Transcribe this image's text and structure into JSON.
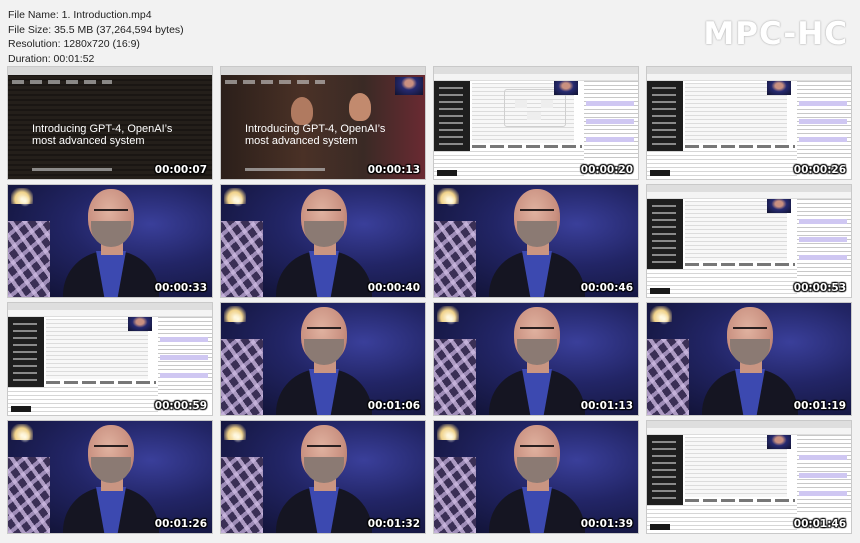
{
  "file_info": {
    "name": "File Name: 1. Introduction.mp4",
    "size": "File Size: 35.5 MB (37,264,594 bytes)",
    "resolution": "Resolution: 1280x720 (16:9)",
    "duration": "Duration: 00:01:52"
  },
  "logo": "MPC-HC",
  "thumbnails": [
    {
      "time": "00:00:07",
      "kind": "intro-code",
      "title": "Introducing GPT-4, OpenAI’s most advanced system"
    },
    {
      "time": "00:00:13",
      "kind": "intro-people",
      "title": "Introducing GPT-4, OpenAI’s most advanced system"
    },
    {
      "time": "00:00:20",
      "kind": "chat-diagram"
    },
    {
      "time": "00:00:26",
      "kind": "chat"
    },
    {
      "time": "00:00:33",
      "kind": "camera"
    },
    {
      "time": "00:00:40",
      "kind": "camera"
    },
    {
      "time": "00:00:46",
      "kind": "camera"
    },
    {
      "time": "00:00:53",
      "kind": "chat"
    },
    {
      "time": "00:00:59",
      "kind": "chat"
    },
    {
      "time": "00:01:06",
      "kind": "camera"
    },
    {
      "time": "00:01:13",
      "kind": "camera"
    },
    {
      "time": "00:01:19",
      "kind": "camera"
    },
    {
      "time": "00:01:26",
      "kind": "camera"
    },
    {
      "time": "00:01:32",
      "kind": "camera"
    },
    {
      "time": "00:01:39",
      "kind": "camera"
    },
    {
      "time": "00:01:46",
      "kind": "chat"
    }
  ]
}
